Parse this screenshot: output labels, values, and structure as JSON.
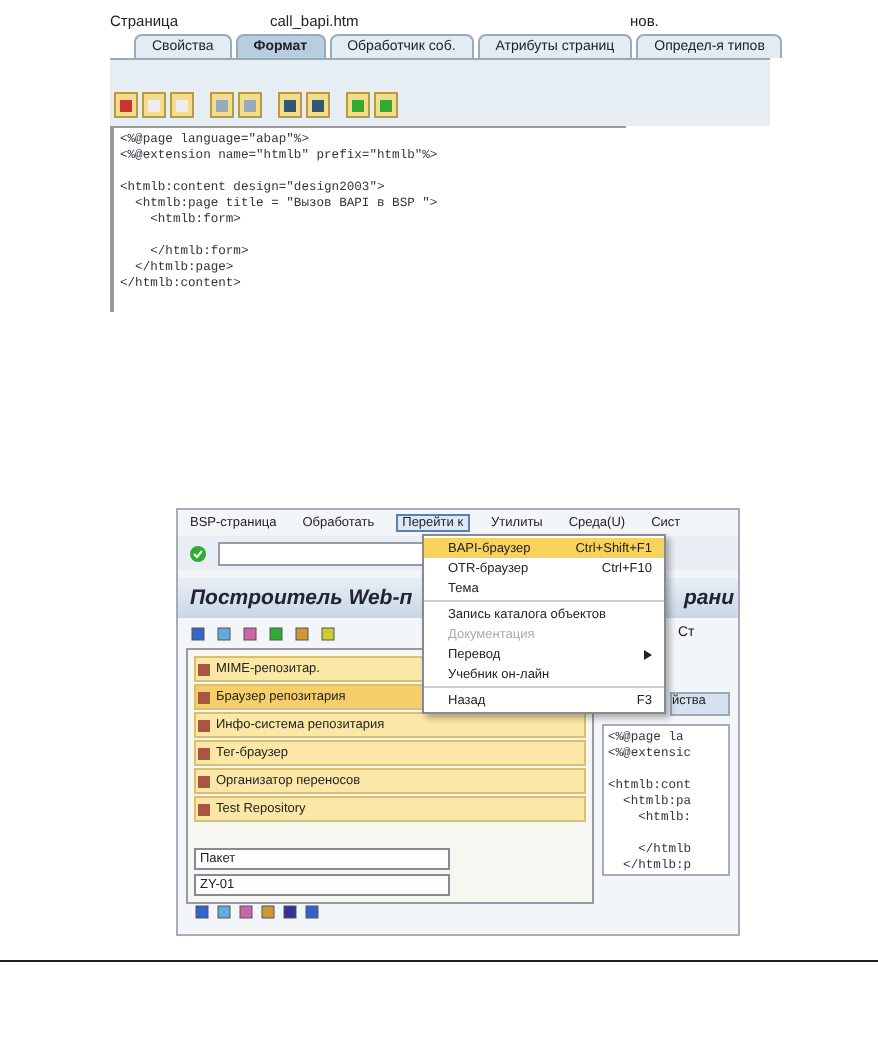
{
  "editor": {
    "page_label": "Страница",
    "page_name": "call_bapi.htm",
    "status": "нов.",
    "tabs": [
      {
        "label": "Свойства",
        "selected": false
      },
      {
        "label": "Формат",
        "selected": true
      },
      {
        "label": "Обработчик соб.",
        "selected": false
      },
      {
        "label": "Атрибуты страниц",
        "selected": false
      },
      {
        "label": "Определ-я типов",
        "selected": false
      }
    ],
    "code_blocks": [
      [
        "<%@page language=\"abap\"%>",
        "<%@extension name=\"htmlb\" prefix=\"htmlb\"%>"
      ],
      [
        "<htmlb:content design=\"design2003\">",
        "  <htmlb:page title = \"Вызов BAPI в BSP \">",
        "    <htmlb:form>"
      ],
      [
        "    </htmlb:form>",
        "  </htmlb:page>",
        "</htmlb:content>"
      ]
    ]
  },
  "builder": {
    "menubar": [
      {
        "label": "BSP-страница",
        "selected": false
      },
      {
        "label": "Обработать",
        "selected": false
      },
      {
        "label": "Перейти к",
        "selected": true
      },
      {
        "label": "Утилиты",
        "selected": false
      },
      {
        "label": "Среда(U)",
        "selected": false
      },
      {
        "label": "Сист",
        "selected": false
      }
    ],
    "menu": [
      {
        "kind": "item",
        "label": "BAPI-браузер",
        "shortcut": "Ctrl+Shift+F1",
        "highlighted": true,
        "disabled": false
      },
      {
        "kind": "item",
        "label": "OTR-браузер",
        "shortcut": "Ctrl+F10",
        "highlighted": false,
        "disabled": false
      },
      {
        "kind": "item",
        "label": "Тема",
        "highlighted": false,
        "disabled": false
      },
      {
        "kind": "separator"
      },
      {
        "kind": "item",
        "label": "Запись каталога объектов",
        "highlighted": false,
        "disabled": false
      },
      {
        "kind": "item",
        "label": "Документация",
        "highlighted": false,
        "disabled": true
      },
      {
        "kind": "submenu",
        "label": "Перевод",
        "highlighted": false,
        "disabled": false
      },
      {
        "kind": "item",
        "label": "Учебник он-лайн",
        "highlighted": false,
        "disabled": false
      },
      {
        "kind": "separator"
      },
      {
        "kind": "item",
        "label": "Назад",
        "shortcut": "F3",
        "highlighted": false,
        "disabled": false
      }
    ],
    "title": "Построитель Web-п",
    "title_tail": "рани",
    "toolbar_tail": "Ст",
    "nav_items": [
      {
        "label": "MIME-репозитар.",
        "selected": false
      },
      {
        "label": "Браузер репозитария",
        "selected": true
      },
      {
        "label": "Инфо-система репозитария",
        "selected": false
      },
      {
        "label": "Тег-браузер",
        "selected": false
      },
      {
        "label": "Организатор переносов",
        "selected": false
      },
      {
        "label": "Test Repository",
        "selected": false
      }
    ],
    "object_type": "Пакет",
    "package": "ZY-01",
    "right_tab": "йства",
    "code_blocks": [
      [
        "<%@page la",
        "<%@extensic"
      ],
      [
        "<htmlb:cont",
        "  <htmlb:pa",
        "    <htmlb:"
      ],
      [
        "    </htmlb",
        "  </htmlb:p"
      ]
    ]
  }
}
